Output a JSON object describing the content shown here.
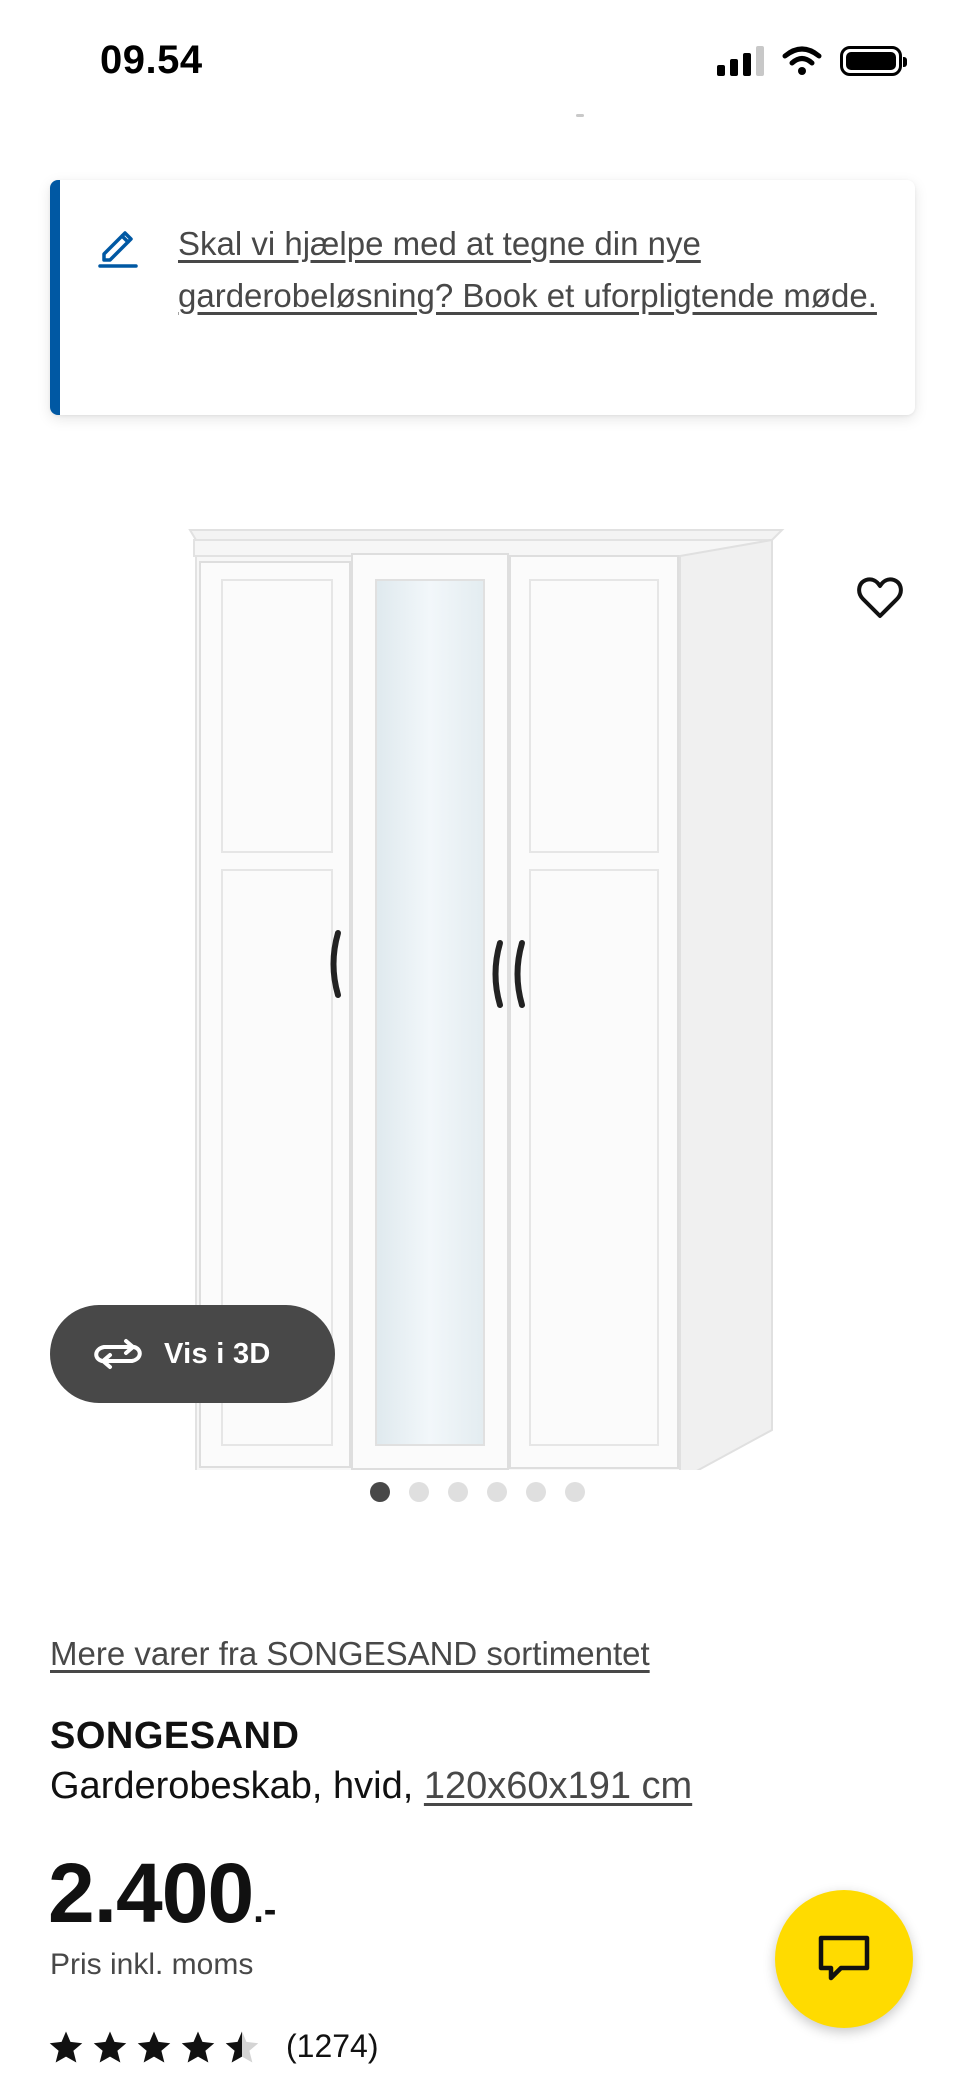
{
  "status_bar": {
    "time": "09.54",
    "icons": [
      "signal-icon",
      "wifi-icon",
      "battery-icon"
    ]
  },
  "banner": {
    "icon": "pencil-icon",
    "link_text": "Skal vi hjælpe med at tegne din nye garderobeløsning? Book et uforpligtende møde.",
    "accent_color": "#0058a3"
  },
  "gallery": {
    "wishlist_icon": "heart-icon",
    "view_3d_label": "Vis i 3D",
    "view_3d_icon": "rotate-icon",
    "image_count": 6,
    "active_index": 0
  },
  "product": {
    "range_link": "Mere varer fra SONGESAND sortimentet",
    "name": "SONGESAND",
    "description": "Garderobeskab, hvid, ",
    "size_link": "120x60x191 cm",
    "price": "2.400",
    "price_suffix": ".-",
    "price_note": "Pris inkl. moms",
    "rating": 4.5,
    "rating_max": 5,
    "review_count": "(1274)"
  },
  "chat": {
    "icon": "chat-icon",
    "color": "#ffdb00"
  }
}
